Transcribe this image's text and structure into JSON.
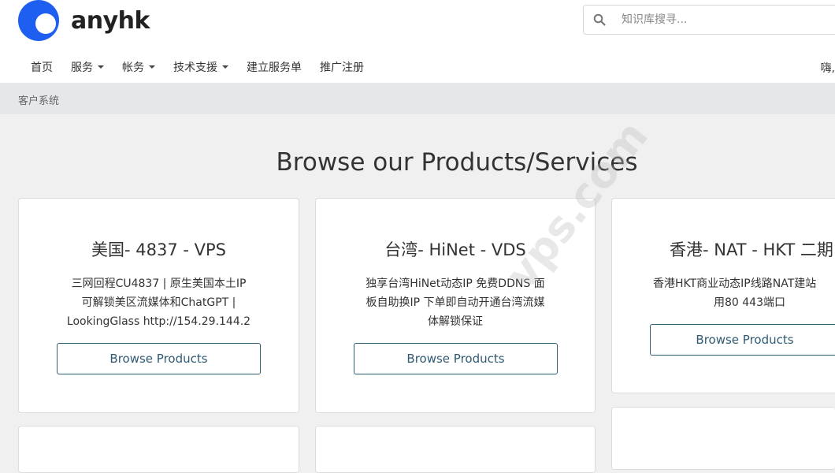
{
  "brand": {
    "name": "anyhk",
    "color": "#1e5ef0"
  },
  "search": {
    "placeholder": "知识库搜寻..."
  },
  "nav": [
    {
      "label": "首页",
      "dropdown": false
    },
    {
      "label": "服务",
      "dropdown": true
    },
    {
      "label": "帐务",
      "dropdown": true
    },
    {
      "label": "技术支援",
      "dropdown": true
    },
    {
      "label": "建立服务单",
      "dropdown": false
    },
    {
      "label": "推广注册",
      "dropdown": false
    }
  ],
  "greeting": "嗨,",
  "breadcrumb": "客户系统",
  "page_title": "Browse our Products/Services",
  "cards": [
    {
      "title": "美国- 4837 - VPS",
      "desc": [
        "三网回程CU4837 | 原生美国本土IP",
        "可解锁美区流媒体和ChatGPT |",
        "LookingGlass http://154.29.144.2"
      ],
      "button": "Browse Products"
    },
    {
      "title": "台湾- HiNet - VDS",
      "desc": [
        "独享台湾HiNet动态IP 免费DDNS 面",
        "板自助换IP 下单即自动开通台湾流媒",
        "体解锁保证"
      ],
      "button": "Browse Products"
    },
    {
      "title": "香港- NAT - HKT 二期",
      "desc": [
        "香港HKT商业动态IP线路NAT建站",
        "用80 443端口"
      ],
      "button": "Browse Products"
    }
  ],
  "watermark": "vps.com"
}
